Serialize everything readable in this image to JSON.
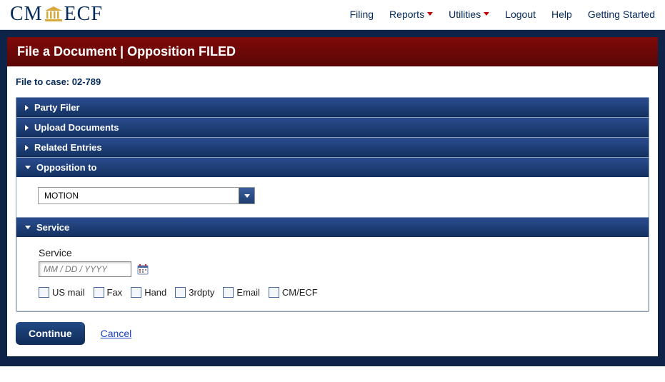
{
  "logo": {
    "pre": "CM",
    "post": "ECF"
  },
  "nav": {
    "filing": "Filing",
    "reports": "Reports",
    "utilities": "Utilities",
    "logout": "Logout",
    "help": "Help",
    "getting_started": "Getting Started"
  },
  "page_title": "File a Document | Opposition FILED",
  "case_label": "File to case: 02-789",
  "sections": {
    "party_filer": "Party Filer",
    "upload_docs": "Upload Documents",
    "related_entries": "Related Entries",
    "opposition_to": "Opposition to",
    "service": "Service"
  },
  "opposition": {
    "selected": "MOTION"
  },
  "service": {
    "label": "Service",
    "date_placeholder": "MM / DD / YYYY",
    "options": {
      "usmail": "US mail",
      "fax": "Fax",
      "hand": "Hand",
      "thirdpty": "3rdpty",
      "email": "Email",
      "cmecf": "CM/ECF"
    }
  },
  "actions": {
    "continue": "Continue",
    "cancel": "Cancel"
  }
}
